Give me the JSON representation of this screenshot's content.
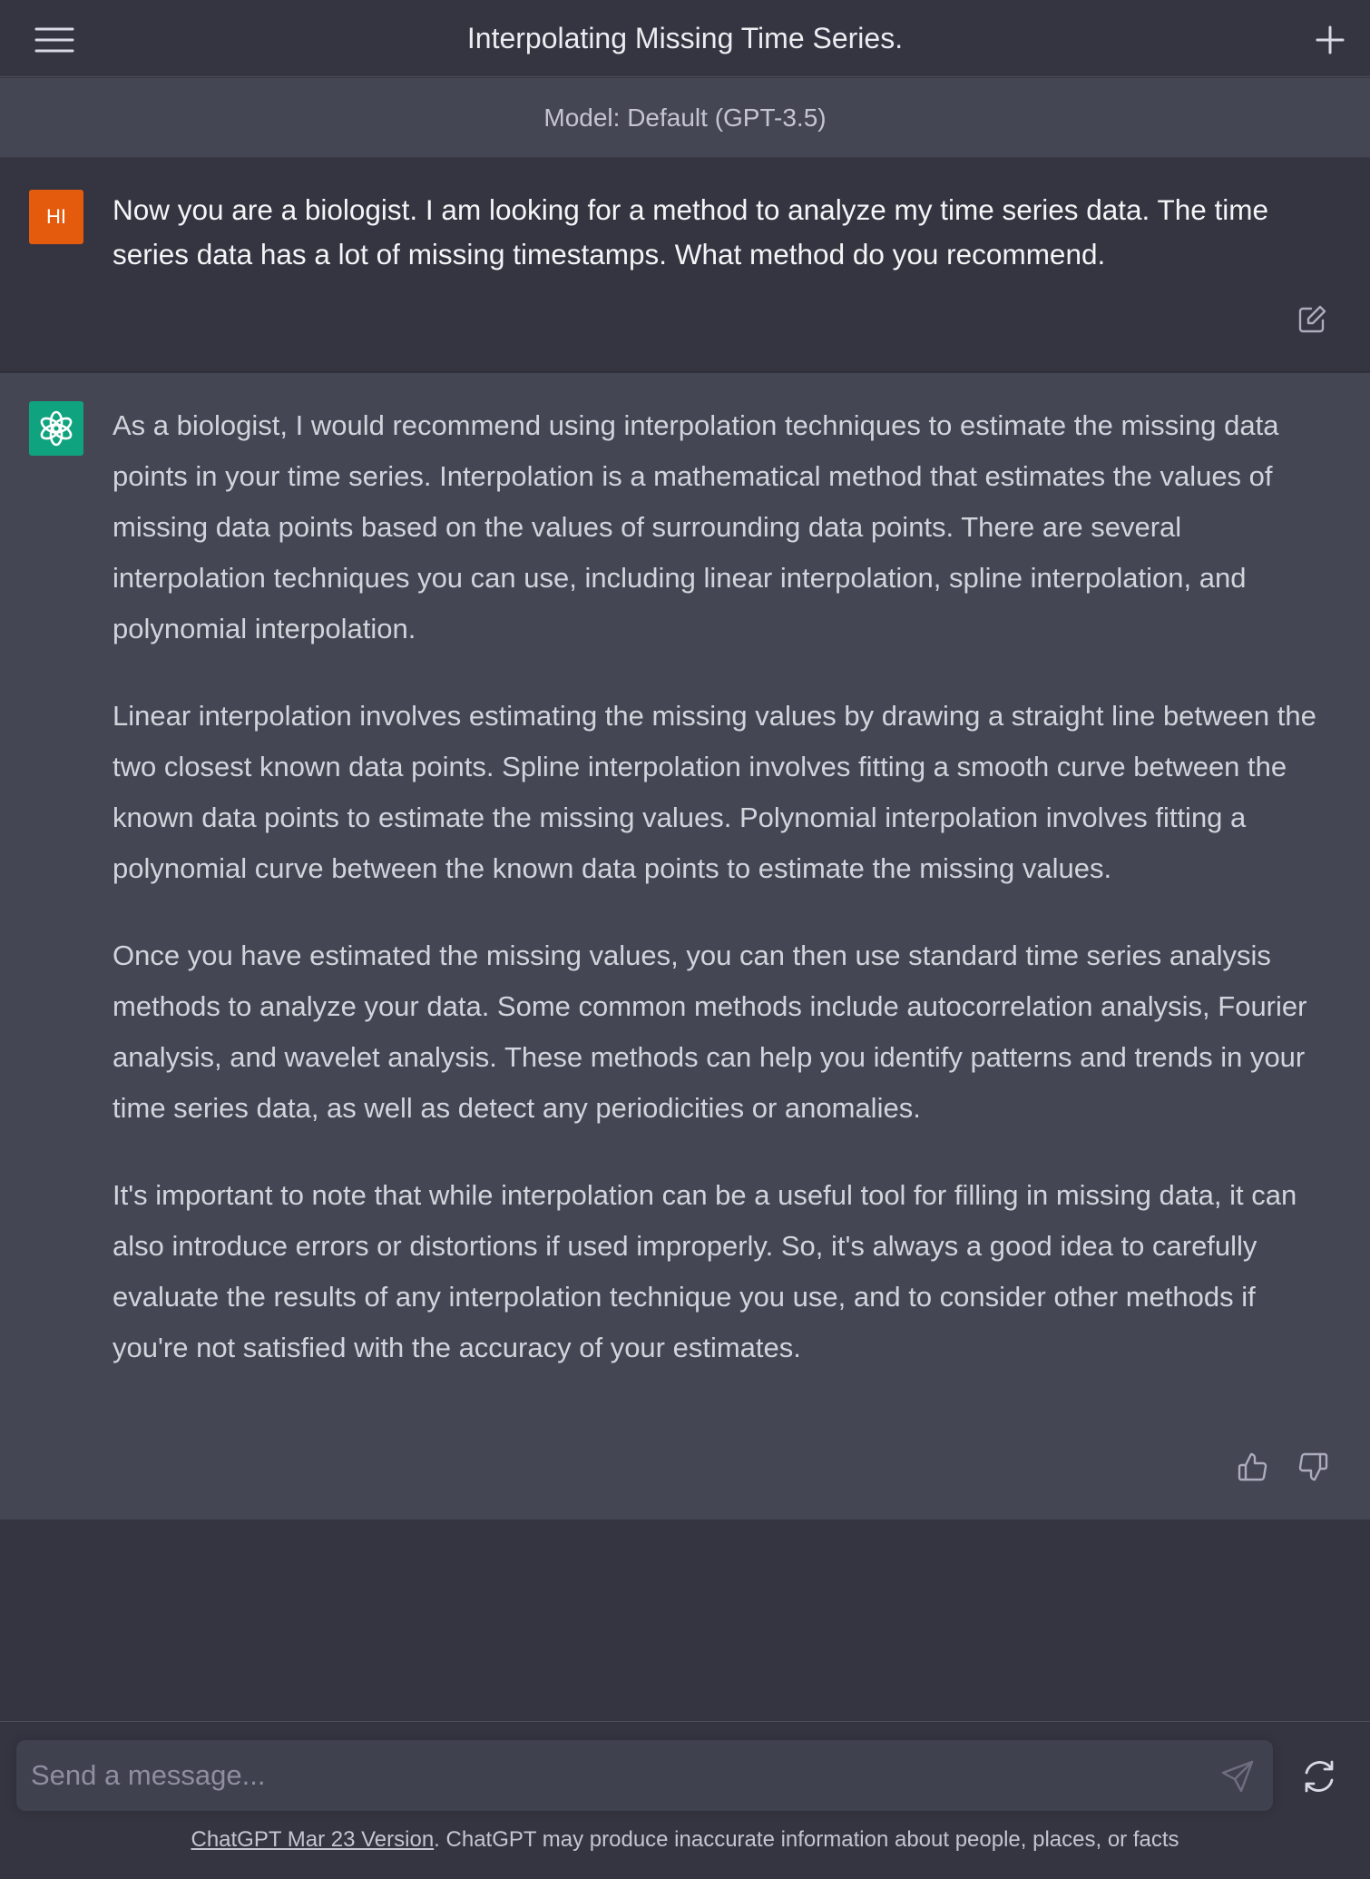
{
  "header": {
    "title": "Interpolating Missing Time Series.",
    "menu_icon": "hamburger-menu-icon",
    "new_chat_icon": "plus-icon"
  },
  "model_bar": {
    "label": "Model: Default (GPT-3.5)"
  },
  "conversation": {
    "user": {
      "avatar_initials": "HI",
      "avatar_color": "#e55b0e",
      "message": "Now you are a biologist. I am looking for a method to analyze my time series data. The time series data has a lot of missing timestamps. What method do you recommend."
    },
    "assistant": {
      "avatar_color": "#10a37f",
      "paragraphs": [
        "As a biologist, I would recommend using interpolation techniques to estimate the missing data points in your time series. Interpolation is a mathematical method that estimates the values of missing data points based on the values of surrounding data points. There are several interpolation techniques you can use, including linear interpolation, spline interpolation, and polynomial interpolation.",
        "Linear interpolation involves estimating the missing values by drawing a straight line between the two closest known data points. Spline interpolation involves fitting a smooth curve between the known data points to estimate the missing values. Polynomial interpolation involves fitting a polynomial curve between the known data points to estimate the missing values.",
        "Once you have estimated the missing values, you can then use standard time series analysis methods to analyze your data. Some common methods include autocorrelation analysis, Fourier analysis, and wavelet analysis. These methods can help you identify patterns and trends in your time series data, as well as detect any periodicities or anomalies.",
        "It's important to note that while interpolation can be a useful tool for filling in missing data, it can also introduce errors or distortions if used improperly. So, it's always a good idea to carefully evaluate the results of any interpolation technique you use, and to consider other methods if you're not satisfied with the accuracy of your estimates."
      ]
    }
  },
  "composer": {
    "placeholder": "Send a message...",
    "send_icon": "send-icon",
    "regenerate_icon": "refresh-icon"
  },
  "footer": {
    "link_text": "ChatGPT Mar 23 Version",
    "disclaimer": ". ChatGPT may produce inaccurate information about people, places, or facts"
  },
  "colors": {
    "background": "#343541",
    "assistant_background": "#444654",
    "input_background": "#40414f"
  }
}
